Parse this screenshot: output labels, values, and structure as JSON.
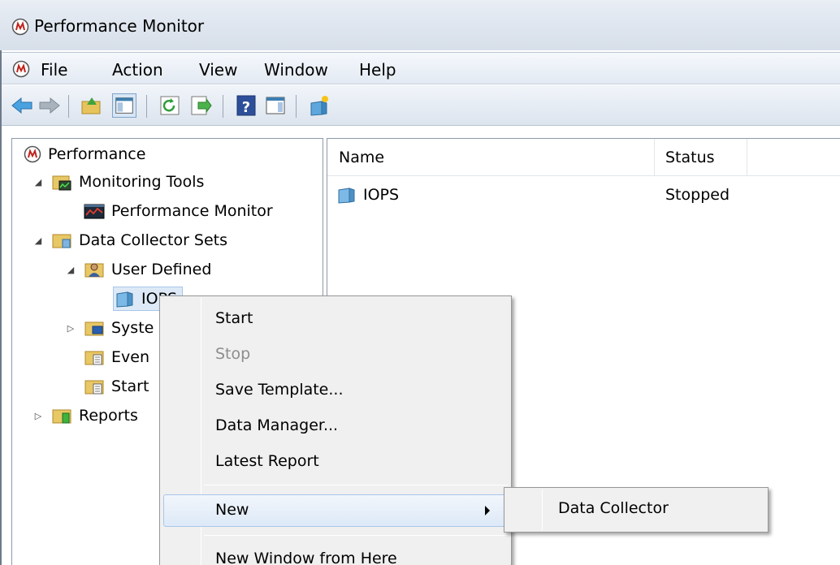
{
  "window": {
    "title": "Performance Monitor"
  },
  "menu": {
    "items": [
      "File",
      "Action",
      "View",
      "Window",
      "Help"
    ]
  },
  "toolbar": {
    "buttons": [
      "back-icon",
      "forward-icon",
      "up-folder-icon",
      "show-hide-tree-icon",
      "refresh-icon",
      "export-icon",
      "help-icon",
      "show-action-pane-icon",
      "new-data-collector-set-icon"
    ]
  },
  "tree": {
    "root": "Performance",
    "monitoring_tools": "Monitoring Tools",
    "performance_monitor": "Performance Monitor",
    "data_collector_sets": "Data Collector Sets",
    "user_defined": "User Defined",
    "iops": "IOPS",
    "system": "Syste",
    "event": "Even",
    "startup": "Start",
    "reports": "Reports"
  },
  "list": {
    "columns": [
      "Name",
      "Status"
    ],
    "rows": [
      {
        "name": "IOPS",
        "status": "Stopped"
      }
    ]
  },
  "context_menu": {
    "start": "Start",
    "stop": "Stop",
    "save_template": "Save Template...",
    "data_manager": "Data Manager...",
    "latest_report": "Latest Report",
    "new": "New",
    "new_window": "New Window from Here"
  },
  "submenu": {
    "data_collector": "Data Collector"
  },
  "colors": {
    "accent_blue": "#3c7fb1",
    "highlight": "#dde9f7"
  }
}
